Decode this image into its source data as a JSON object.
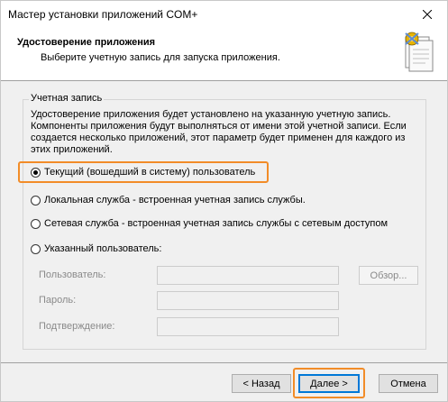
{
  "window": {
    "title": "Мастер установки приложений COM+"
  },
  "header": {
    "title": "Удостоверение приложения",
    "subtitle": "Выберите учетную запись для запуска приложения."
  },
  "account_group": {
    "legend": "Учетная запись",
    "description": "Удостоверение приложения будет установлено на указанную учетную запись. Компоненты приложения будут выполняться от имени этой учетной записи. Если создается несколько приложений, этот параметр будет применен для каждого из этих приложений.",
    "options": [
      {
        "label": "Текущий (вошедший в систему) пользователь",
        "checked": true
      },
      {
        "label": "Локальная служба - встроенная учетная запись службы.",
        "checked": false
      },
      {
        "label": "Сетевая служба - встроенная учетная запись службы с сетевым доступом",
        "checked": false
      },
      {
        "label": "Указанный пользователь:",
        "checked": false
      }
    ],
    "user_label": "Пользователь:",
    "user_value": "",
    "password_label": "Пароль:",
    "password_value": "",
    "confirm_label": "Подтверждение:",
    "confirm_value": "",
    "browse_label": "Обзор..."
  },
  "footer": {
    "back_label": "< Назад",
    "next_label": "Далее >",
    "cancel_label": "Отмена"
  },
  "colors": {
    "highlight": "#f28c28",
    "default_button_border": "#0078d7"
  }
}
